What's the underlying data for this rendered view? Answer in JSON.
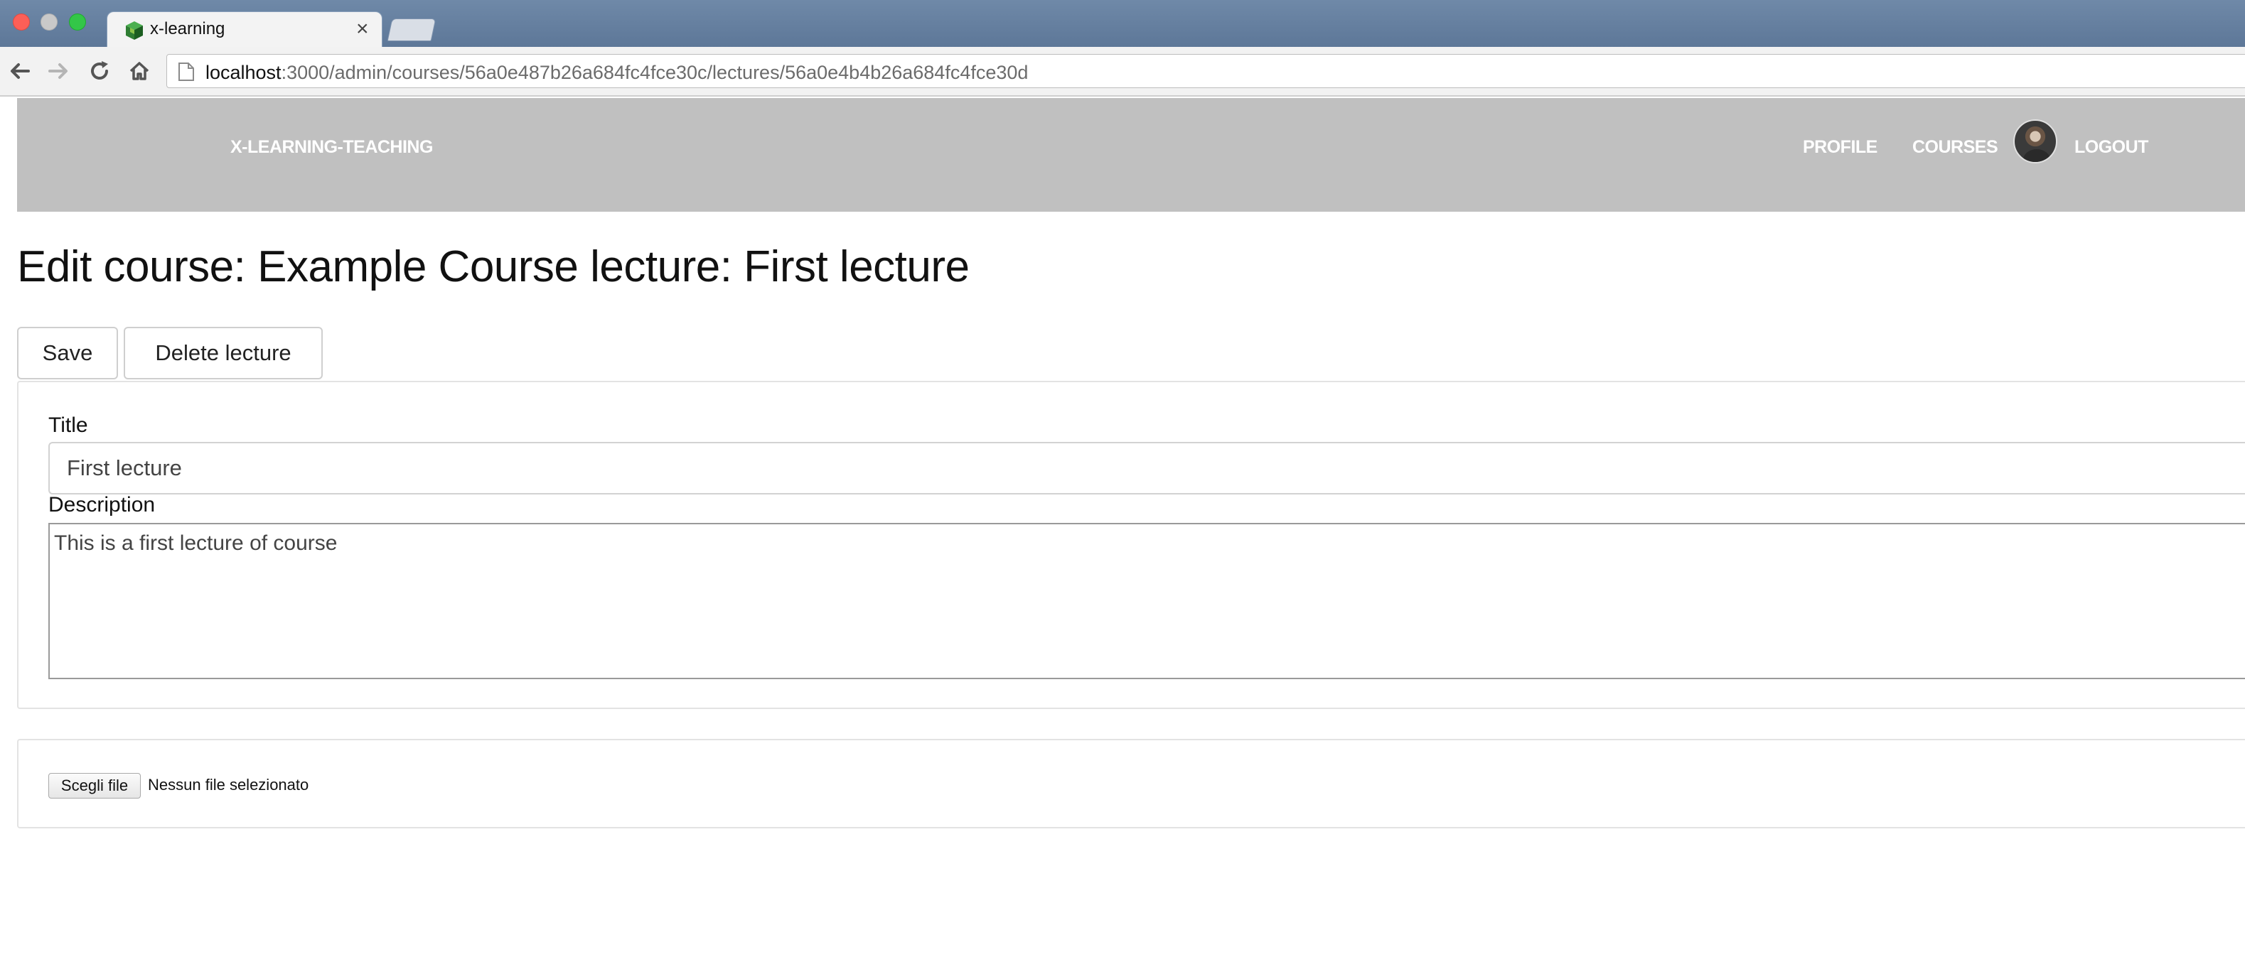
{
  "browser": {
    "tab_title": "x-learning",
    "url_host": "localhost",
    "url_path": ":3000/admin/courses/56a0e487b26a684fc4fce30c/lectures/56a0e4b4b26a684fc4fce30d"
  },
  "navbar": {
    "brand": "X-LEARNING-TEACHING",
    "links": {
      "profile": "PROFILE",
      "courses": "COURSES",
      "logout": "LOGOUT"
    }
  },
  "page": {
    "title": "Edit course: Example Course lecture: First lecture"
  },
  "actions": {
    "save_label": "Save",
    "delete_label": "Delete lecture"
  },
  "form": {
    "title_label": "Title",
    "title_value": "First lecture",
    "description_label": "Description",
    "description_value": "This is a first lecture of course"
  },
  "upload": {
    "choose_file_label": "Scegli file",
    "no_file_text": "Nessun file selezionato"
  }
}
